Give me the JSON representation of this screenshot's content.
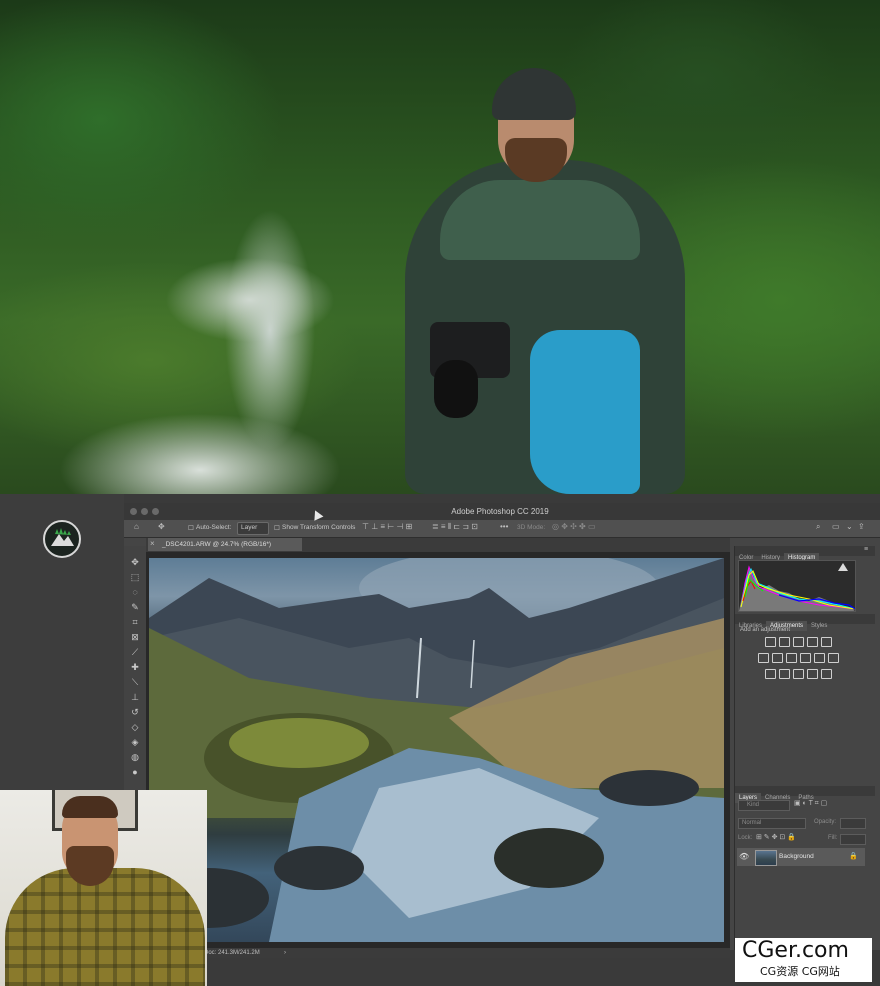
{
  "app": {
    "window_title": "Adobe Photoshop CC 2019"
  },
  "options_bar": {
    "auto_select_label": "Auto-Select:",
    "auto_select_value": "Layer",
    "show_transform_label": "Show Transform Controls",
    "mode_3d_label": "3D Mode:"
  },
  "document": {
    "tab_label": "_DSC4201.ARW @ 24.7% (RGB/16*)",
    "status_text": "Doc: 241.3M/241.2M"
  },
  "tools": [
    "move-tool",
    "marquee-tool",
    "lasso-tool",
    "quick-select-tool",
    "crop-tool",
    "frame-tool",
    "eyedropper-tool",
    "healing-tool",
    "brush-tool",
    "clone-stamp-tool",
    "history-brush-tool",
    "eraser-tool",
    "paint-bucket-tool",
    "blur-tool",
    "dodge-tool"
  ],
  "panels": {
    "top_tabs": [
      "Color",
      "History",
      "Histogram"
    ],
    "top_active": "Histogram",
    "mid_tabs": [
      "Libraries",
      "Adjustments",
      "Styles"
    ],
    "mid_active": "Adjustments",
    "adjustments_hint": "Add an adjustment",
    "layers_tabs": [
      "Layers",
      "Channels",
      "Paths"
    ],
    "layers_active": "Layers",
    "layer_filter_placeholder": "Kind",
    "blend_mode": "Normal",
    "opacity_label": "Opacity:",
    "lock_label": "Lock:",
    "fill_label": "Fill:",
    "layers": [
      {
        "name": "Background",
        "visible": true,
        "locked": true
      }
    ]
  },
  "histogram_colors": [
    "#ff00ff",
    "#00ffff",
    "#ffff00",
    "#0000ff",
    "#ff0000",
    "#00ff00"
  ],
  "watermark": {
    "main": "CGer.com",
    "sub": "CG资源 CG网站"
  }
}
